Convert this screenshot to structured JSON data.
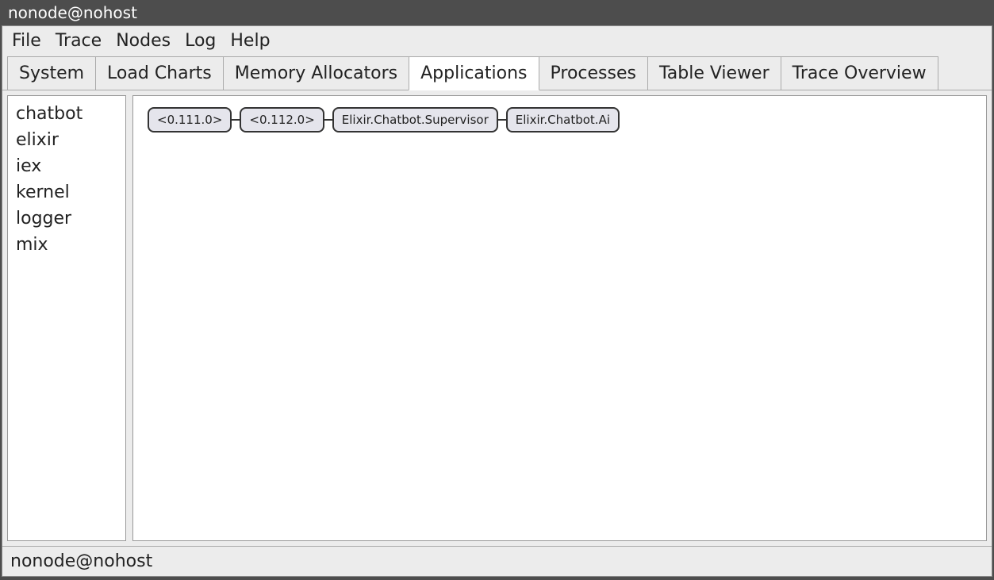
{
  "titlebar": {
    "text": "nonode@nohost"
  },
  "menubar": {
    "items": [
      "File",
      "Trace",
      "Nodes",
      "Log",
      "Help"
    ]
  },
  "tabs": {
    "items": [
      {
        "label": "System",
        "active": false
      },
      {
        "label": "Load Charts",
        "active": false
      },
      {
        "label": "Memory Allocators",
        "active": false
      },
      {
        "label": "Applications",
        "active": true
      },
      {
        "label": "Processes",
        "active": false
      },
      {
        "label": "Table Viewer",
        "active": false
      },
      {
        "label": "Trace Overview",
        "active": false
      }
    ]
  },
  "sidebar": {
    "apps": [
      "chatbot",
      "elixir",
      "iex",
      "kernel",
      "logger",
      "mix"
    ]
  },
  "process_tree": {
    "nodes": [
      "<0.111.0>",
      "<0.112.0>",
      "Elixir.Chatbot.Supervisor",
      "Elixir.Chatbot.Ai"
    ]
  },
  "statusbar": {
    "text": "nonode@nohost"
  }
}
